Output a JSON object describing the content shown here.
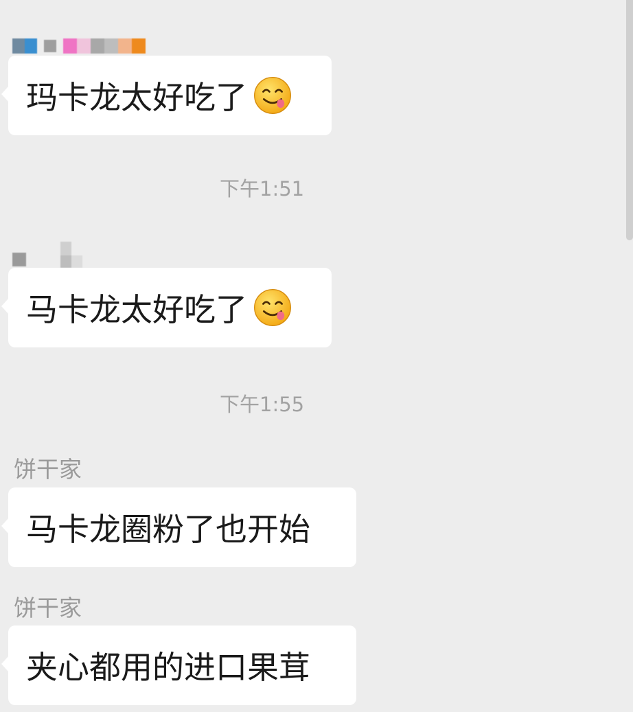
{
  "chat": {
    "messages": [
      {
        "sender": "",
        "text": "玛卡龙太好吃了",
        "emoji": "yum-face-emoji"
      },
      {
        "timestamp": "下午1:51"
      },
      {
        "sender": "",
        "text": "马卡龙太好吃了",
        "emoji": "yum-face-emoji"
      },
      {
        "timestamp": "下午1:55"
      },
      {
        "sender": "饼干家",
        "text": "马卡龙圈粉了也开始"
      },
      {
        "sender": "饼干家",
        "text": "夹心都用的进口果茸"
      }
    ]
  },
  "colors": {
    "background": "#ededed",
    "bubble": "#ffffff",
    "text": "#1a1a1a",
    "meta_text": "#9a9a9a"
  }
}
